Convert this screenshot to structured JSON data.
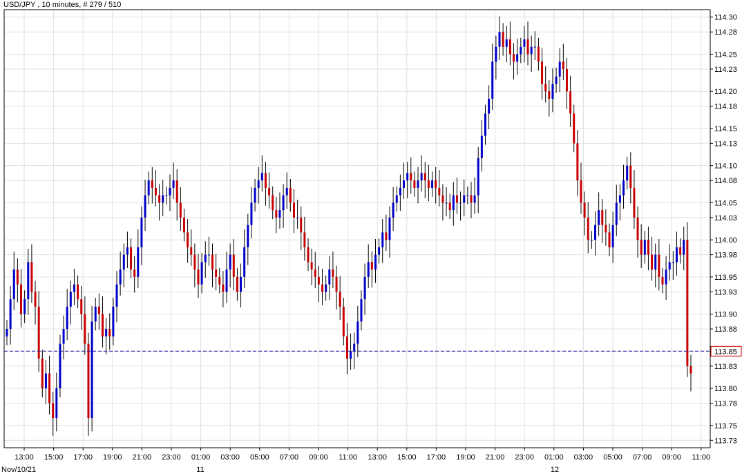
{
  "title": "USD/JPY , 10 minutes, # 279 / 510",
  "colors": {
    "up": "#0000c8",
    "down": "#c80000",
    "wick": "#000000",
    "grid": "#e0e0e0",
    "current_line": "#2020a0",
    "current_box": "#c80000",
    "axis": "#000000"
  },
  "chart_data": {
    "type": "candlestick",
    "symbol": "USD/JPY",
    "interval": "10 minutes",
    "bar_index": "# 279 / 510",
    "grid": true,
    "ylim": [
      113.72,
      114.31
    ],
    "y_ticks": [
      "114.30",
      "114.28",
      "114.25",
      "114.23",
      "114.20",
      "114.18",
      "114.15",
      "114.13",
      "114.10",
      "114.08",
      "114.05",
      "114.03",
      "114.00",
      "113.98",
      "113.95",
      "113.93",
      "113.90",
      "113.88",
      "113.85",
      "113.83",
      "113.80",
      "113.78",
      "113.75",
      "113.73"
    ],
    "x_ticks": [
      "13:00",
      "15:00",
      "17:00",
      "19:00",
      "21:00",
      "23:00",
      "01:00",
      "03:00",
      "05:00",
      "07:00",
      "09:00",
      "11:00",
      "13:00",
      "15:00",
      "17:00",
      "19:00",
      "21:00",
      "23:00",
      "01:00",
      "03:00",
      "05:00",
      "07:00",
      "09:00",
      "11:00"
    ],
    "date_labels": [
      "Nov/10/21",
      "11",
      "12"
    ],
    "current_price": "113.85",
    "close_series": [
      113.88,
      113.92,
      113.96,
      113.94,
      113.9,
      113.92,
      113.97,
      113.93,
      113.91,
      113.84,
      113.8,
      113.82,
      113.78,
      113.76,
      113.8,
      113.86,
      113.88,
      113.91,
      113.93,
      113.94,
      113.92,
      113.9,
      113.86,
      113.76,
      113.89,
      113.91,
      113.9,
      113.87,
      113.88,
      113.87,
      113.91,
      113.94,
      113.96,
      113.98,
      113.99,
      113.96,
      113.95,
      113.99,
      114.03,
      114.06,
      114.08,
      114.07,
      114.06,
      114.05,
      114.06,
      114.06,
      114.07,
      114.08,
      114.05,
      114.03,
      114.01,
      113.99,
      113.98,
      113.96,
      113.94,
      113.97,
      113.98,
      113.98,
      113.96,
      113.95,
      113.94,
      113.93,
      113.96,
      113.98,
      113.95,
      113.93,
      113.95,
      113.99,
      114.02,
      114.05,
      114.07,
      114.08,
      114.09,
      114.07,
      114.06,
      114.04,
      114.03,
      114.04,
      114.06,
      114.07,
      114.05,
      114.03,
      114.03,
      114.01,
      113.99,
      113.97,
      113.96,
      113.95,
      113.94,
      113.93,
      113.94,
      113.96,
      113.95,
      113.93,
      113.91,
      113.87,
      113.84,
      113.85,
      113.86,
      113.89,
      113.92,
      113.95,
      113.97,
      113.96,
      113.98,
      113.99,
      114.01,
      114.0,
      114.03,
      114.05,
      114.06,
      114.07,
      114.08,
      114.09,
      114.08,
      114.07,
      114.08,
      114.09,
      114.08,
      114.07,
      114.08,
      114.07,
      114.06,
      114.05,
      114.05,
      114.04,
      114.06,
      114.05,
      114.05,
      114.06,
      114.06,
      114.05,
      114.06,
      114.11,
      114.14,
      114.17,
      114.19,
      114.24,
      114.26,
      114.28,
      114.26,
      114.27,
      114.25,
      114.24,
      114.25,
      114.26,
      114.27,
      114.25,
      114.26,
      114.26,
      114.24,
      114.21,
      114.2,
      114.19,
      114.21,
      114.22,
      114.24,
      114.23,
      114.2,
      114.17,
      114.13,
      114.08,
      114.05,
      114.03,
      114.0,
      114.0,
      114.02,
      114.04,
      114.02,
      114.01,
      113.99,
      114.02,
      114.05,
      114.06,
      114.08,
      114.1,
      114.07,
      114.03,
      114.0,
      113.98,
      114.0,
      113.98,
      113.96,
      113.98,
      113.95,
      113.94,
      113.96,
      113.97,
      113.97,
      113.99,
      113.98,
      114.0,
      113.83,
      113.82
    ]
  }
}
